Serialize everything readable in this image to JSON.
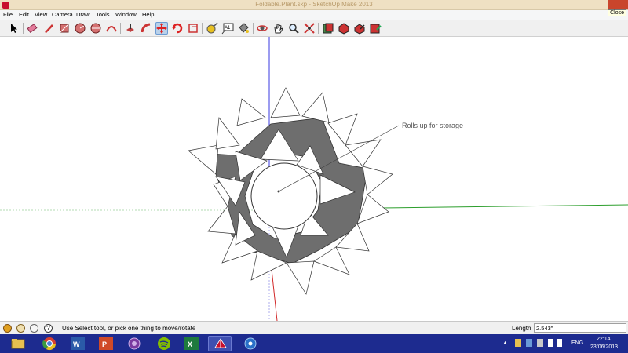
{
  "window": {
    "title": "Foldable.Plant.skp - SketchUp Make 2013",
    "close_tooltip": "Close"
  },
  "menu": [
    "File",
    "Edit",
    "View",
    "Camera",
    "Draw",
    "Tools",
    "Window",
    "Help"
  ],
  "toolbar_icons": [
    "select-arrow-icon",
    "eraser-icon",
    "pencil-icon",
    "rectangle-icon",
    "circle-icon",
    "polygon-icon",
    "arc-icon",
    "push-pull-icon",
    "follow-me-icon",
    "move-icon",
    "rotate-icon",
    "offset-icon",
    "tape-measure-icon",
    "text-icon",
    "axes-icon",
    "paint-bucket-icon",
    "orbit-icon",
    "pan-icon",
    "zoom-icon",
    "zoom-extents-icon",
    "components-icon",
    "get-models-icon",
    "share-model-icon",
    "share-component-icon"
  ],
  "viewport": {
    "annotation": "Rolls up for storage"
  },
  "status": {
    "hint": "Use Select tool, or pick one thing to move/rotate",
    "length_label": "Length",
    "length_value": "2.543\""
  },
  "taskbar": {
    "apps": [
      "file-explorer",
      "chrome",
      "word",
      "powerpoint",
      "tor-browser",
      "spotify",
      "excel",
      "sketchup",
      "media-app"
    ],
    "language": "ENG",
    "time": "22:14",
    "date": "23/06/2013"
  },
  "colors": {
    "taskbar": "#1d2b8f",
    "axis_blue": "#3a3ae0",
    "axis_green": "#2c9e2c",
    "axis_red": "#d22a2a",
    "face_dark": "#6e6e6e"
  }
}
